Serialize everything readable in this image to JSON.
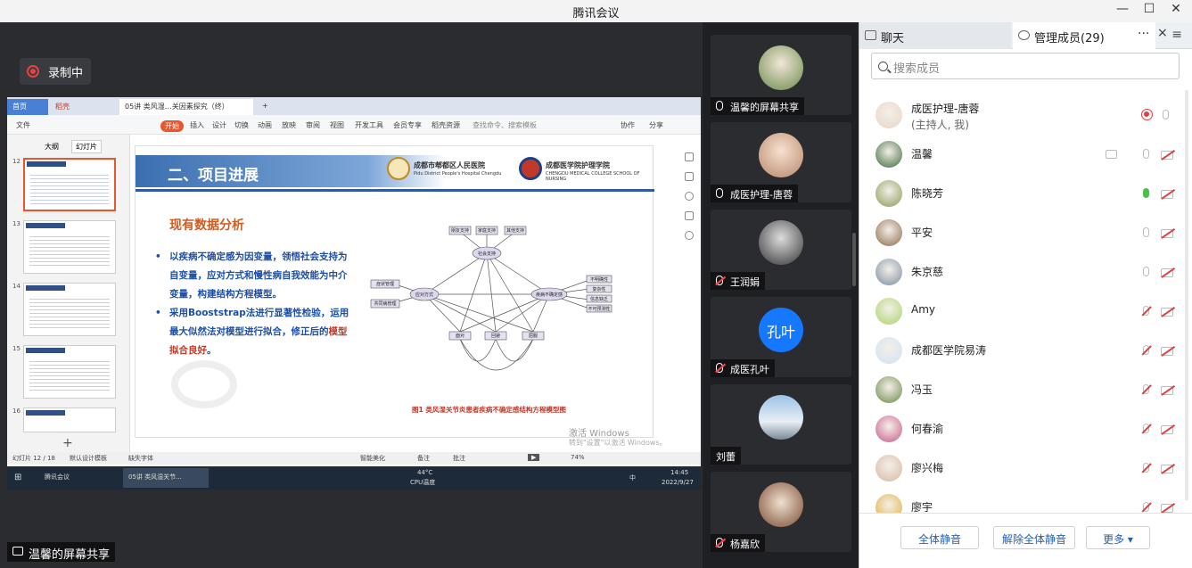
{
  "window": {
    "title": "腾讯会议"
  },
  "recording": {
    "label": "录制中"
  },
  "share_label": "温馨的屏幕共享",
  "shared_screen": {
    "tabs": {
      "home": "首页",
      "wps": "稻壳",
      "doc": "05讲 类风湿…关因素探究（终）"
    },
    "menu": [
      "文件",
      "开始",
      "插入",
      "设计",
      "切换",
      "动画",
      "放映",
      "审阅",
      "视图",
      "开发工具",
      "会员专享",
      "稻壳资源"
    ],
    "menu_search": "查找命令、搜索模板",
    "menu_right": [
      "协作",
      "分享"
    ],
    "panel_tabs": [
      "大纲",
      "幻灯片"
    ],
    "thumb_numbers": [
      "12",
      "13",
      "14",
      "15",
      "16"
    ],
    "slide": {
      "heading": "二、项目进展",
      "logo1_cn": "成都市郫都区人民医院",
      "logo1_en": "Pidu District People's Hospital Chengdu",
      "logo2_cn": "成都医学院护理学院",
      "logo2_en": "CHENGDU MEDICAL COLLEGE SCHOOL OF NURSING",
      "subtitle": "现有数据分析",
      "bullet1": "以疾病不确定感为因变量，领悟社会支持为自变量，应对方式和慢性病自我效能为中介变量，构建结构方程模型。",
      "bullet2_a": "采用Booststrap法进行显著性检验，运用最大似然法对模型进行拟合，修正后的",
      "bullet2_hl": "模型拟合良好",
      "bullet2_end": "。",
      "caption": "图1 类风湿关节炎患者疾病不确定感结构方程模型图",
      "diagram_nodes": [
        "社会支持",
        "朋友支持",
        "家庭支持",
        "其他支持",
        "应对方式",
        "面对",
        "回避",
        "屈服",
        "慢性病自我效能",
        "症状管理",
        "共同病管理",
        "疾病不确定感",
        "不明确性",
        "复杂性",
        "信息缺乏",
        "不可预测性"
      ]
    },
    "watermark": "激活 Windows",
    "watermark2": "转到\"设置\"以激活 Windows。",
    "statusbar": {
      "slide": "幻灯片 12 / 18",
      "template": "默认设计模板",
      "font": "缺失字体",
      "smart": "智能美化",
      "notes": "备注",
      "comments": "批注",
      "zoom": "74%"
    },
    "taskbar": {
      "app1": "腾讯会议",
      "app2": "05讲 类风湿关节...",
      "temp": "44°C",
      "temp_label": "CPU温度",
      "ime": "中",
      "time": "14:45",
      "date": "2022/9/27"
    }
  },
  "video_tiles": [
    {
      "name": "温馨的屏幕共享",
      "icon": "screen-share"
    },
    {
      "name": "成医护理-唐蓉",
      "icon": "person"
    },
    {
      "name": "王润娟",
      "icon": "mic-muted"
    },
    {
      "name": "成医孔叶",
      "icon": "mic-muted",
      "avatar_text": "孔叶"
    },
    {
      "name": "刘蕾",
      "icon": ""
    },
    {
      "name": "杨嘉欣",
      "icon": "mic-muted"
    }
  ],
  "panel": {
    "tab_chat": "聊天",
    "tab_members": "管理成员(29)",
    "more": "···",
    "close": "×",
    "search_placeholder": "搜索成员",
    "members": [
      {
        "name": "成医护理-唐蓉",
        "sub": "(主持人, 我)",
        "mic": "idle",
        "rec": true,
        "color": "#e8d5c8"
      },
      {
        "name": "温馨",
        "sub": "",
        "mic": "idle",
        "cam": "off",
        "screen": true,
        "color": "#3b6b3a"
      },
      {
        "name": "陈晓芳",
        "sub": "",
        "mic": "on",
        "cam": "off",
        "color": "#8a9a5a"
      },
      {
        "name": "平安",
        "sub": "",
        "mic": "idle",
        "cam": "off",
        "color": "#8b6b4a"
      },
      {
        "name": "朱京慈",
        "sub": "",
        "mic": "idle",
        "cam": "off",
        "color": "#7a8ea3"
      },
      {
        "name": "Amy",
        "sub": "",
        "mic": "off",
        "cam": "off",
        "color": "#a9d46a"
      },
      {
        "name": "成都医学院易涛",
        "sub": "",
        "mic": "off",
        "cam": "off",
        "color": "#cfe3f2"
      },
      {
        "name": "冯玉",
        "sub": "",
        "mic": "off",
        "cam": "off",
        "color": "#6a8a4a"
      },
      {
        "name": "何春渝",
        "sub": "",
        "mic": "off",
        "cam": "off",
        "color": "#c85a8a"
      },
      {
        "name": "廖兴梅",
        "sub": "",
        "mic": "off",
        "cam": "off",
        "color": "#d8b8a0"
      },
      {
        "name": "廖宇",
        "sub": "",
        "mic": "off",
        "cam": "off",
        "color": "#e0b040"
      }
    ],
    "buttons": {
      "mute_all": "全体静音",
      "unmute_all": "解除全体静音",
      "more": "更多 ▾"
    }
  },
  "colors": {
    "accent": "#1f5fbf",
    "record": "#e64340",
    "mic_on": "#4cbf4c",
    "muted": "#e04040"
  }
}
